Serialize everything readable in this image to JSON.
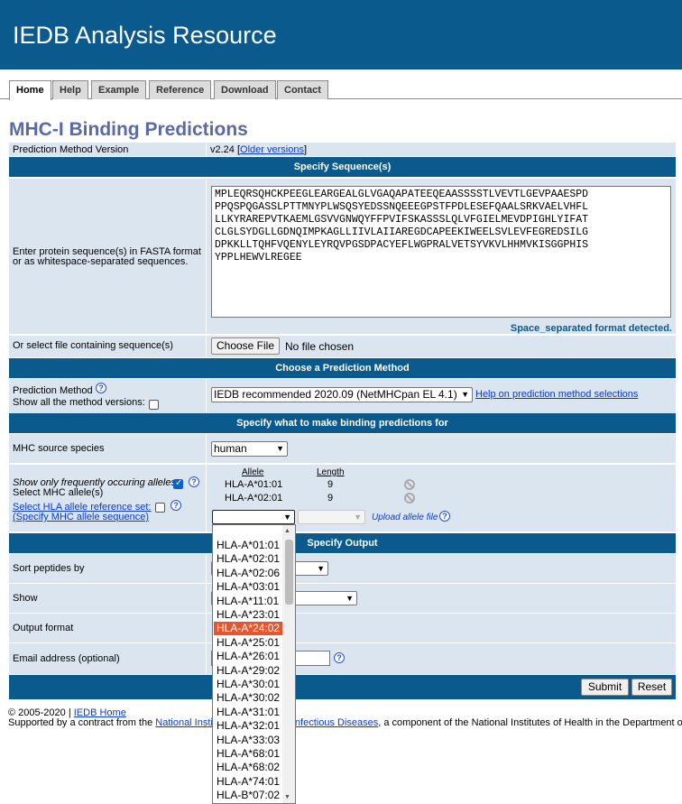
{
  "banner": {
    "title": "IEDB Analysis Resource"
  },
  "tabs": [
    "Home",
    "Help",
    "Example",
    "Reference",
    "Download",
    "Contact"
  ],
  "page_title": "MHC-I Binding Predictions",
  "version": {
    "label": "Prediction Method Version",
    "value": "v2.24",
    "link": "Older versions"
  },
  "seq_section": {
    "header": "Specify Sequence(s)",
    "label": "Enter protein sequence(s) in FASTA format or as whitespace-separated sequences.",
    "sequence": "MPLEQRSQHCKPEEGLEARGEALGLVGAQAPATEEQEAASSSSTLVEVTLGEVPAAESPD\nPPQSPQGASSLPTTMNYPLWSQSYEDSSNQEEEGPSTFPDLESEFQAALSRKVAELVHFL\nLLKYRAREPVTKAEMLGSVVGNWQYFFPVIFSKASSSLQLVFGIELMEVDPIGHLYIFAT\nCLGLSYDGLLGDNQIMPKAGLLIIVLAIIAREGDCAPEEKIWEELSVLEVFEGREDSILG\nDPKKLLTQHFVQENYLEYRQVPGSDPACYEFLWGPRALVETSYVKVLHHMVKISGGPHIS\nYPPLHEWVLREGEE",
    "detected": "Space_separated format detected.",
    "file_label": "Or select file containing sequence(s)",
    "file_button": "Choose File",
    "file_status": "No file chosen"
  },
  "method_section": {
    "header": "Choose a Prediction Method",
    "label": "Prediction Method",
    "show_all": "Show all the method versions:",
    "selected": "IEDB recommended 2020.09 (NetMHCpan EL 4.1)",
    "help_link": "Help on prediction method selections"
  },
  "predict_section": {
    "header": "Specify what to make binding predictions for",
    "species_label": "MHC source species",
    "species": "human",
    "freq_label": "Show only frequently occuring alleles:",
    "select_label": "Select MHC allele(s)",
    "ref_link": "Select HLA allele reference set:",
    "ref_link2": "(Specify MHC allele sequence)",
    "col_allele": "Allele",
    "col_length": "Length",
    "selected_alleles": [
      {
        "allele": "HLA-A*01:01",
        "length": "9"
      },
      {
        "allele": "HLA-A*02:01",
        "length": "9"
      }
    ],
    "upload": "Upload allele file"
  },
  "output_section": {
    "header": "Specify Output",
    "sort_label": "Sort peptides by",
    "show_label": "Show",
    "format_label": "Output format",
    "email_label": "Email address (optional)"
  },
  "buttons": {
    "submit": "Submit",
    "reset": "Reset"
  },
  "dropdown": {
    "options": [
      "HLA-A*01:01",
      "HLA-A*02:01",
      "HLA-A*02:06",
      "HLA-A*03:01",
      "HLA-A*11:01",
      "HLA-A*23:01",
      "HLA-A*24:02",
      "HLA-A*25:01",
      "HLA-A*26:01",
      "HLA-A*29:02",
      "HLA-A*30:01",
      "HLA-A*30:02",
      "HLA-A*31:01",
      "HLA-A*32:01",
      "HLA-A*33:03",
      "HLA-A*68:01",
      "HLA-A*68:02",
      "HLA-A*74:01",
      "HLA-B*07:02"
    ],
    "highlighted": "HLA-A*24:02"
  },
  "footer": {
    "copyright": "© 2005-2020 |",
    "home_link": "IEDB Home",
    "support_pre": "Supported by a contract from the",
    "support_link1": "National Instit",
    "support_link2": "nfectious Diseases",
    "support_post": ", a component of the National Institutes of Health in the Department of H"
  },
  "colors": {
    "banner": "#0a5a8e",
    "row": "#dbe5ef",
    "title": "#5a6aa8",
    "highlight": "#e8552c"
  }
}
